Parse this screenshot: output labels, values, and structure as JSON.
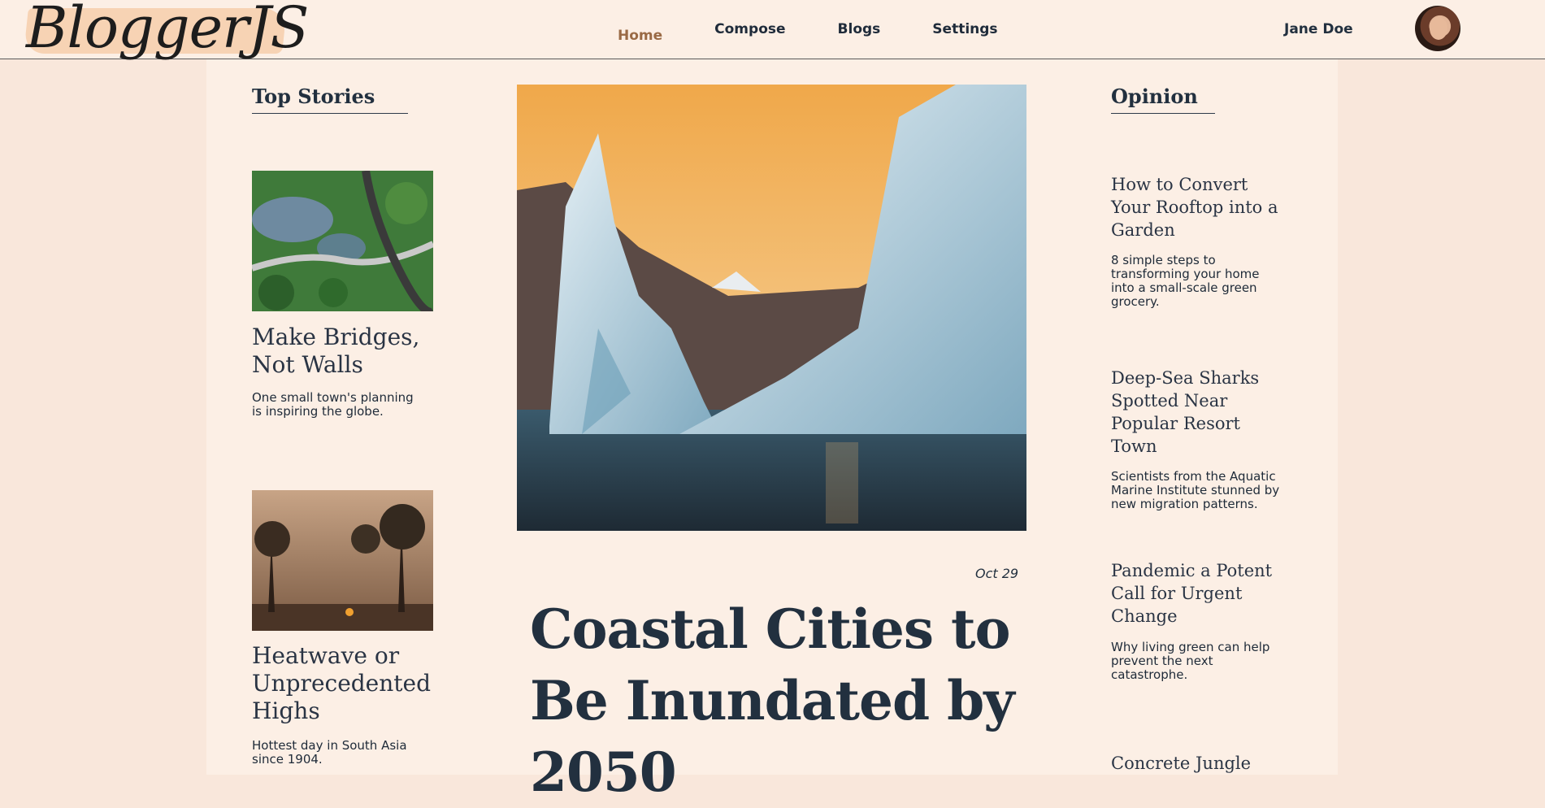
{
  "header": {
    "logo": "BloggerJS",
    "nav": [
      "Home",
      "Compose",
      "Blogs",
      "Settings"
    ],
    "active": "Home",
    "user_name": "Jane Doe"
  },
  "top_stories": {
    "title": "Top Stories",
    "items": [
      {
        "title": "Make Bridges, Not Walls",
        "subtitle": "One small town's planning is inspiring the globe."
      },
      {
        "title": "Heatwave or Unprecedented Highs",
        "subtitle": "Hottest day in South Asia since 1904."
      }
    ]
  },
  "featured": {
    "date": "Oct 29",
    "headline": "Coastal Cities to Be Inundated by 2050"
  },
  "opinion": {
    "title": "Opinion",
    "items": [
      {
        "title": "How to Convert Your Rooftop into a Garden",
        "subtitle": "8 simple steps to transforming your home into a small-scale green grocery."
      },
      {
        "title": "Deep-Sea Sharks Spotted Near Popular Resort Town",
        "subtitle": "Scientists from the Aquatic Marine Institute stunned by new migration patterns."
      },
      {
        "title": "Pandemic a Potent Call for Urgent Change",
        "subtitle": "Why living green can help prevent the next catastrophe."
      },
      {
        "title": "Concrete Jungle",
        "subtitle": ""
      }
    ]
  },
  "colors": {
    "page_bg": "#f9e7db",
    "panel_bg": "#fcefe5",
    "text": "#22303f",
    "active_nav": "#9a6a45"
  }
}
